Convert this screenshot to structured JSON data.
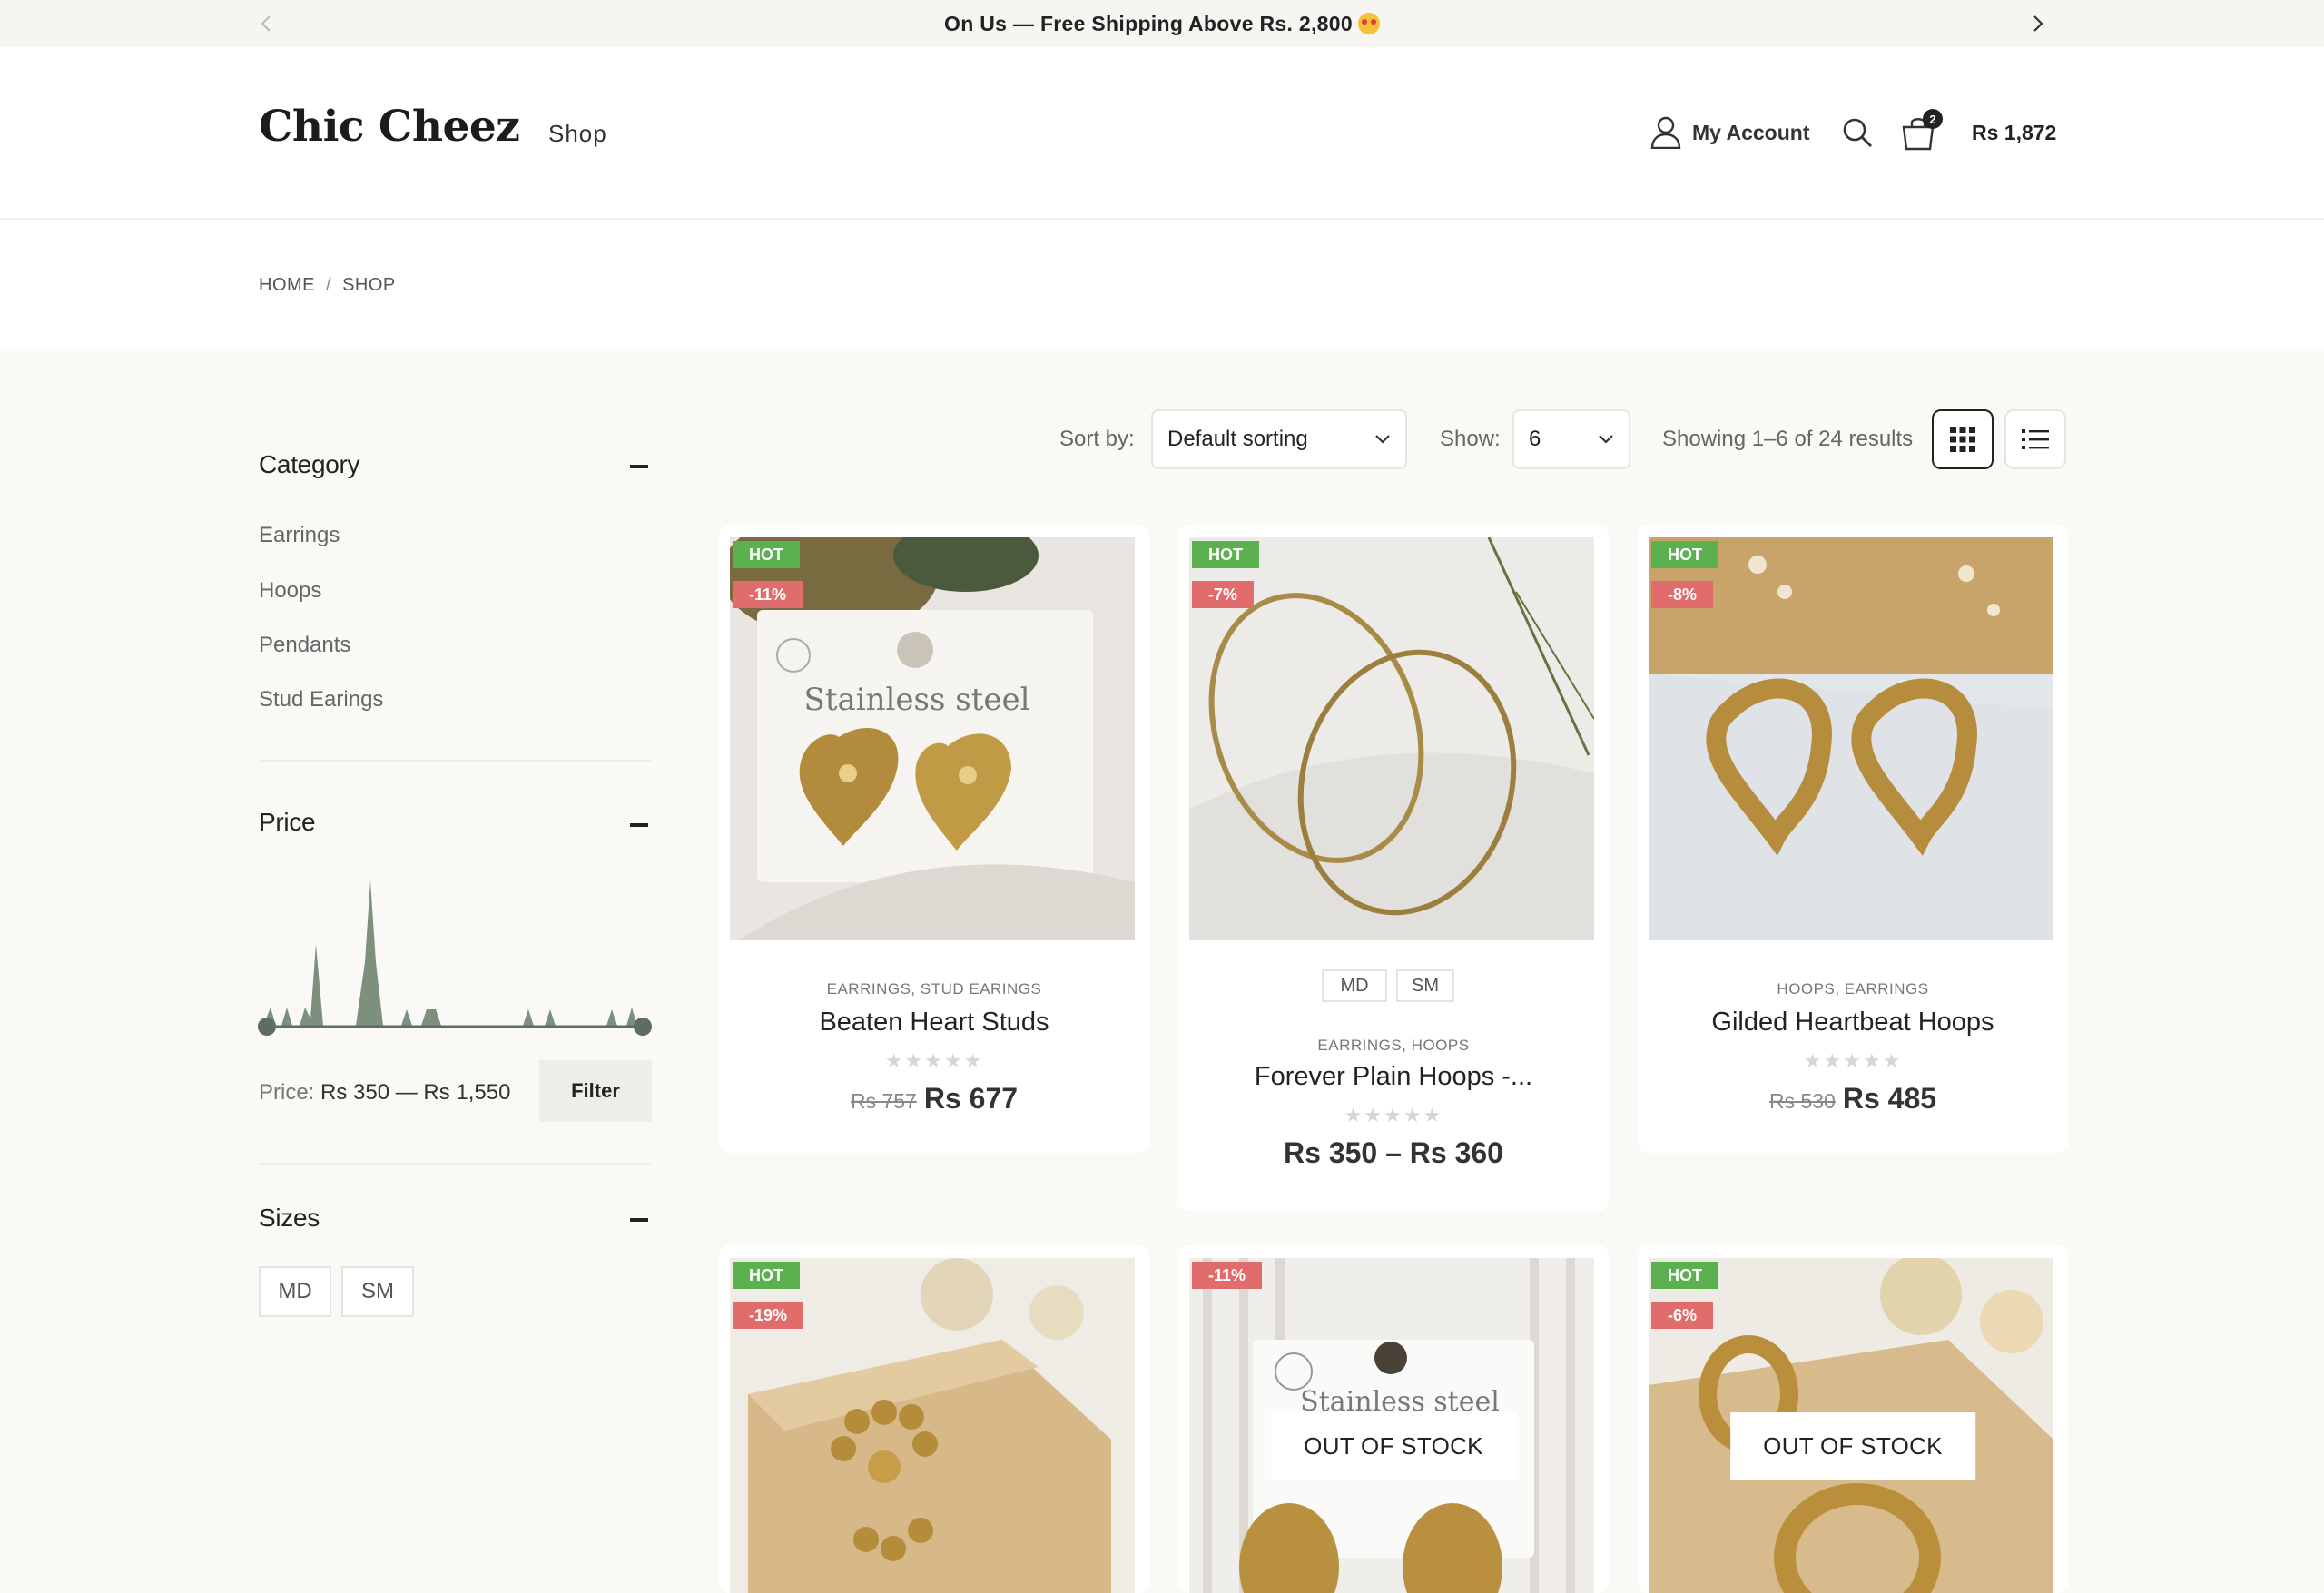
{
  "announcement": {
    "message": "On Us — Free Shipping Above Rs. 2,800"
  },
  "header": {
    "logo": "Chic Cheez",
    "nav_shop": "Shop",
    "account_label": "My Account",
    "cart_count": "2",
    "cart_total": "Rs 1,872"
  },
  "breadcrumb": {
    "home": "HOME",
    "separator": "/",
    "current": "SHOP"
  },
  "sidebar": {
    "category_title": "Category",
    "categories": [
      "Earrings",
      "Hoops",
      "Pendants",
      "Stud Earings"
    ],
    "price_title": "Price",
    "price_prefix": "Price:",
    "price_range": "Rs 350 — Rs 1,550",
    "filter_label": "Filter",
    "sizes_title": "Sizes",
    "sizes": [
      "MD",
      "SM"
    ]
  },
  "toolbar": {
    "sort_label": "Sort by:",
    "sort_value": "Default sorting",
    "show_label": "Show:",
    "show_value": "6",
    "results_text": "Showing 1–6 of 24 results"
  },
  "products": [
    {
      "hot": "HOT",
      "discount": "-11%",
      "categories": "EARRINGS, STUD EARINGS",
      "title": "Beaten Heart Studs",
      "old_price": "Rs 757",
      "price": "Rs 677",
      "stars": "★★★★★"
    },
    {
      "hot": "HOT",
      "discount": "-7%",
      "variants": [
        "MD",
        "SM"
      ],
      "categories": "EARRINGS, HOOPS",
      "title": "Forever Plain Hoops -...",
      "price": "Rs 350 – Rs 360",
      "stars": "★★★★★"
    },
    {
      "hot": "HOT",
      "discount": "-8%",
      "categories": "HOOPS, EARRINGS",
      "title": "Gilded Heartbeat Hoops",
      "old_price": "Rs 530",
      "price": "Rs 485",
      "stars": "★★★★★"
    },
    {
      "hot": "HOT",
      "discount": "-19%"
    },
    {
      "discount": "-11%",
      "stock": "OUT OF STOCK"
    },
    {
      "hot": "HOT",
      "discount": "-6%",
      "stock": "OUT OF STOCK"
    }
  ],
  "image_text": {
    "card_brand": "Stainless steel"
  },
  "colors": {
    "hot_badge": "#5bb04f",
    "discount_badge": "#e06c6c",
    "histogram": "#7d8f7d"
  }
}
